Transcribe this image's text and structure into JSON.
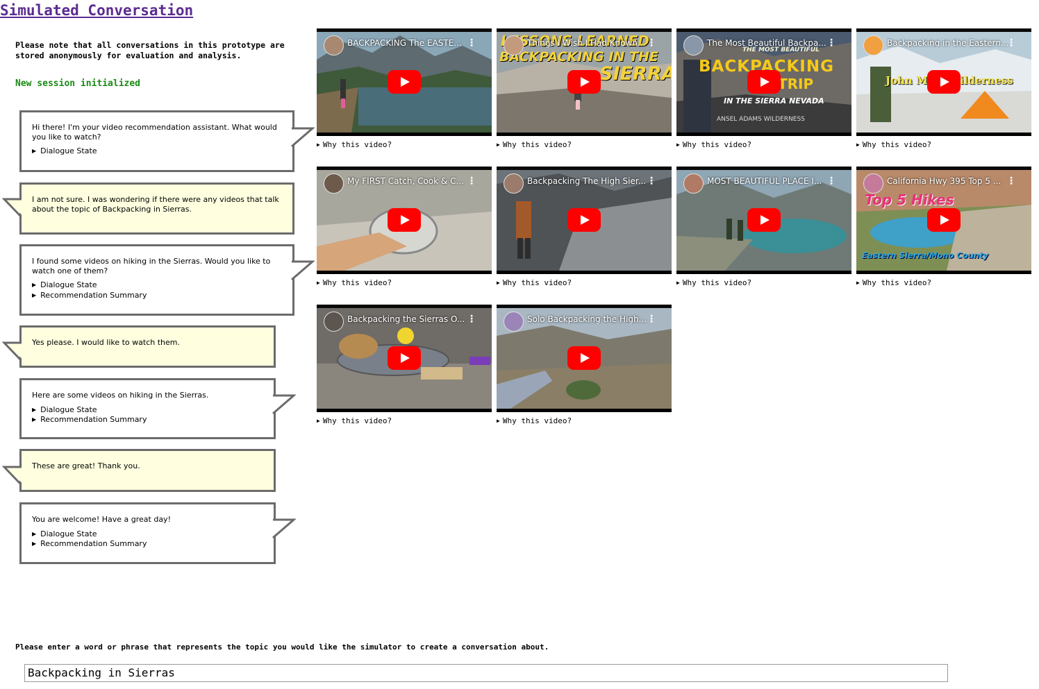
{
  "page": {
    "title": "Simulated Conversation",
    "note": "Please note that all conversations in this prototype are stored anonymously for evaluation and analysis.",
    "session_status": "New session initialized",
    "status_color": "#1a8a14"
  },
  "conversation": [
    {
      "role": "assistant",
      "text": "Hi there! I'm your video recommendation assistant. What would you like to watch?",
      "details": [
        "Dialogue State"
      ]
    },
    {
      "role": "user",
      "text": "I am not sure. I was wondering if there were any videos that talk about the topic of Backpacking in Sierras.",
      "details": []
    },
    {
      "role": "assistant",
      "text": "I found some videos on hiking in the Sierras. Would you like to watch one of them?",
      "details": [
        "Dialogue State",
        "Recommendation Summary"
      ]
    },
    {
      "role": "user",
      "text": "Yes please. I would like to watch them.",
      "details": []
    },
    {
      "role": "assistant",
      "text": "Here are some videos on hiking in the Sierras.",
      "details": [
        "Dialogue State",
        "Recommendation Summary"
      ]
    },
    {
      "role": "user",
      "text": "These are great! Thank you.",
      "details": []
    },
    {
      "role": "assistant",
      "text": "You are welcome! Have a great day!",
      "details": [
        "Dialogue State",
        "Recommendation Summary"
      ]
    }
  ],
  "videos": [
    {
      "title": "BACKPACKING The EASTE...",
      "why": "Why this video?",
      "overlay": []
    },
    {
      "title": "Things I Wish I Had Known...",
      "why": "Why this video?",
      "overlay": [
        "LESSONS LEARNED",
        "BACKPACKING IN THE",
        "SIERRA"
      ]
    },
    {
      "title": "The Most Beautiful Backpa...",
      "why": "Why this video?",
      "overlay": [
        "THE MOST BEAUTIFUL",
        "BACKPACKING",
        "TRIP",
        "IN THE SIERRA NEVADA",
        "ANSEL ADAMS WILDERNESS"
      ]
    },
    {
      "title": "Backpacking in the Eastern...",
      "why": "Why this video?",
      "overlay": [
        "John Muir Wilderness"
      ]
    },
    {
      "title": "My FIRST Catch, Cook & C...",
      "why": "Why this video?",
      "overlay": []
    },
    {
      "title": "Backpacking The High Sier...",
      "why": "Why this video?",
      "overlay": []
    },
    {
      "title": "MOST BEAUTIFUL PLACE I...",
      "why": "Why this video?",
      "overlay": []
    },
    {
      "title": "California Hwy 395 Top 5 ...",
      "why": "Why this video?",
      "overlay": [
        "Top 5 Hikes",
        "Eastern Sierra/Mono County"
      ]
    },
    {
      "title": "Backpacking the Sierras O...",
      "why": "Why this video?",
      "overlay": []
    },
    {
      "title": "Solo Backpacking the High...",
      "why": "Why this video?",
      "overlay": []
    }
  ],
  "topic_input": {
    "label": "Please enter a word or phrase that represents the topic you would like the simulator to create a conversation about.",
    "value": "Backpacking in Sierras"
  },
  "colors": {
    "title": "#5b2c91",
    "user_bubble": "#ffffe0",
    "bubble_border": "#6b6b6b",
    "play_button": "#ff0000"
  },
  "icons": {
    "play": "youtube-play-icon",
    "menu": "more-vert-icon",
    "disclosure": "triangle-right-icon"
  }
}
